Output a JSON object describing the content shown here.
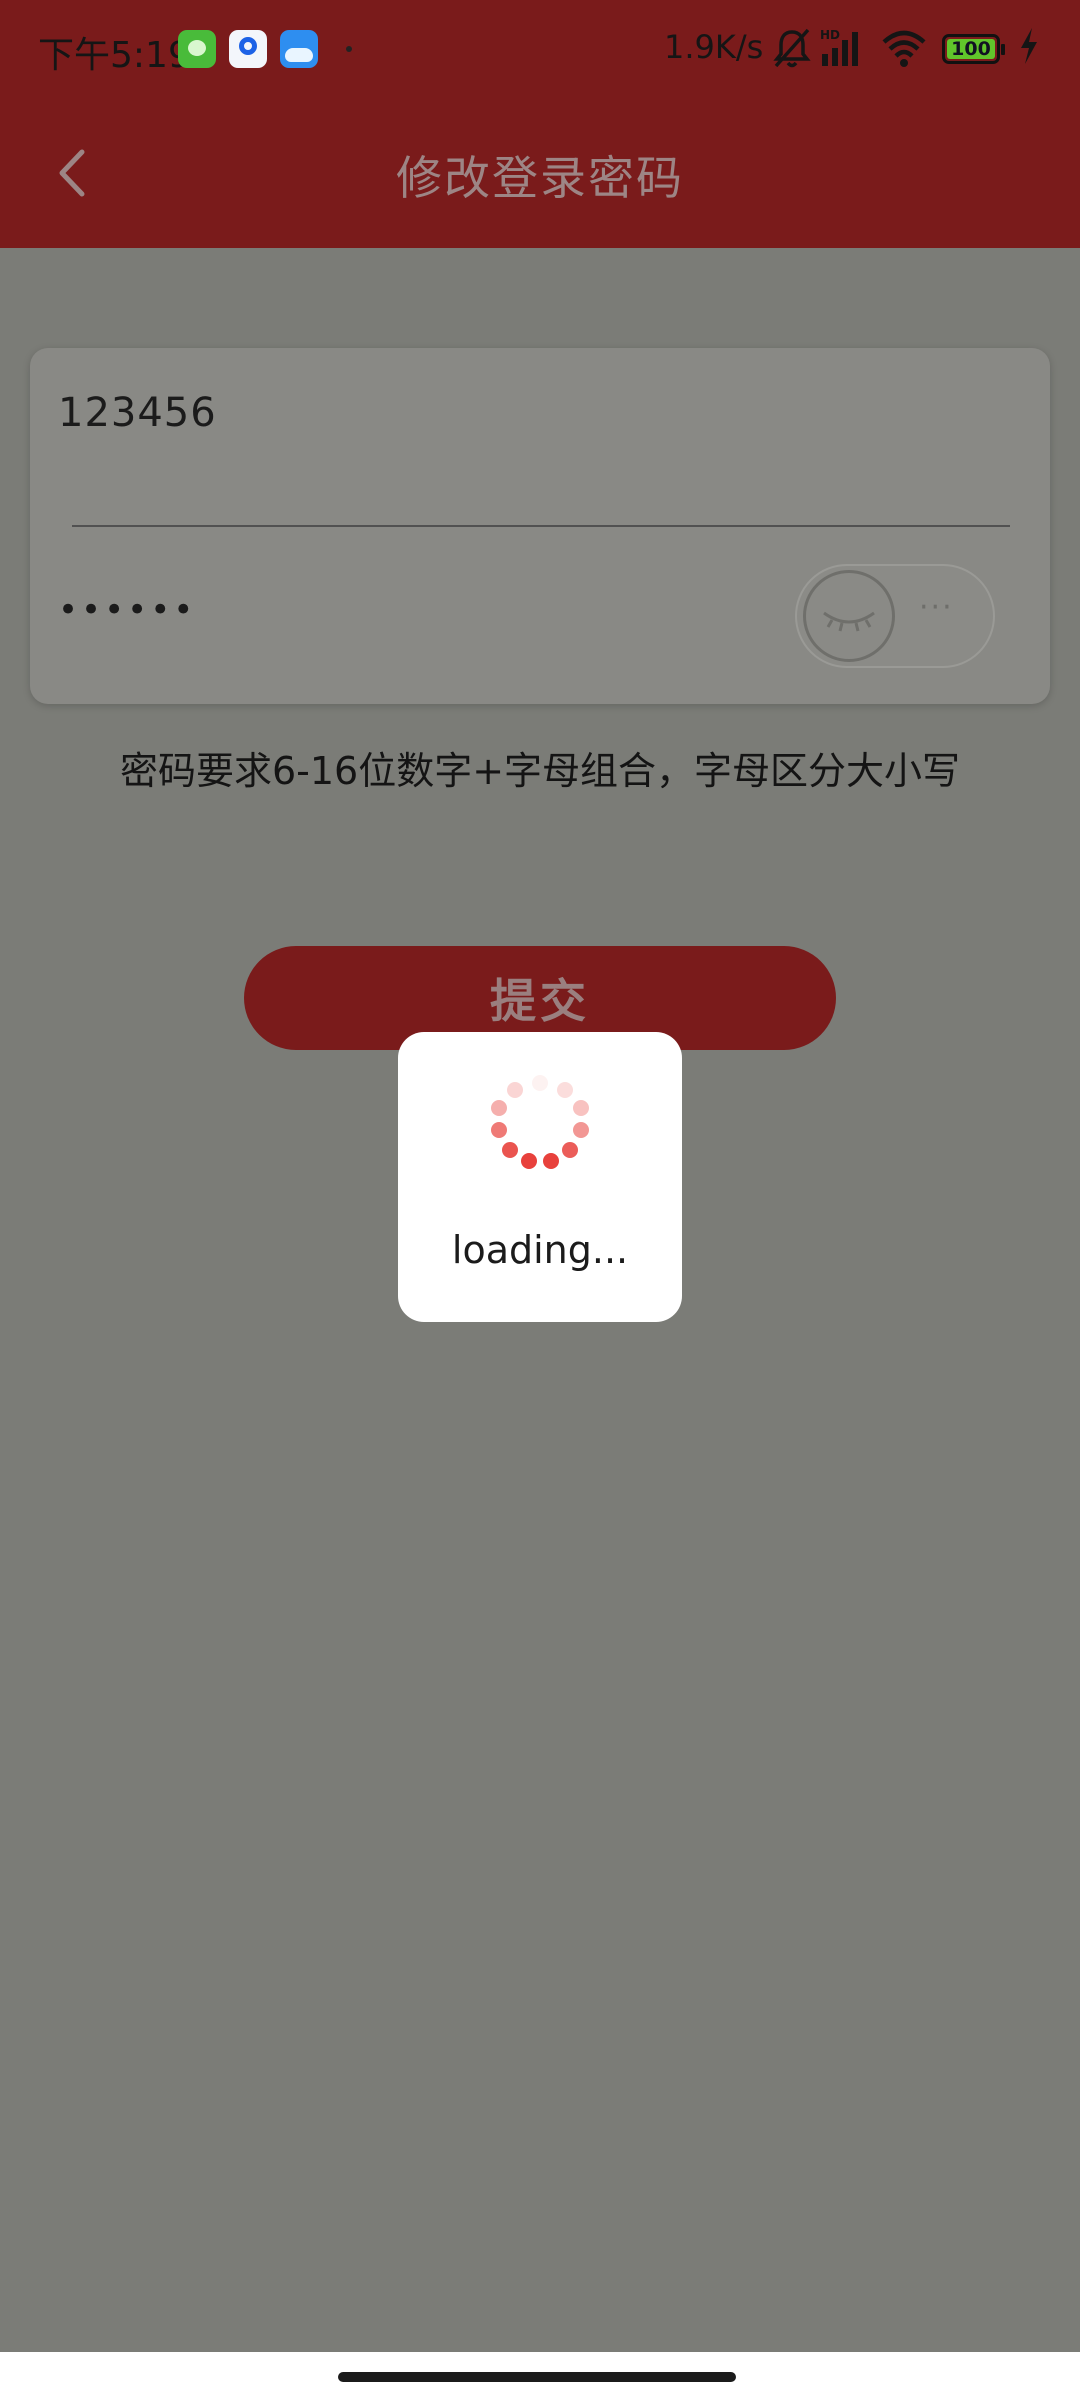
{
  "status_bar": {
    "time": "下午5:19",
    "network_speed": "1.9K/s",
    "battery_level": "100",
    "icons": [
      "cat-app-icon",
      "browser-app-icon",
      "cloud-app-icon",
      "mute-icon",
      "hd-signal-icon",
      "wifi-icon",
      "battery-icon",
      "charging-icon"
    ]
  },
  "header": {
    "title": "修改登录密码",
    "back_icon": "chevron-left-icon"
  },
  "form": {
    "new_password_value": "123456",
    "confirm_password_masked": "••••••",
    "visibility_toggle_icon": "eye-closed-icon",
    "hint": "密码要求6-16位数字+字母组合，字母区分大小写"
  },
  "submit_label": "提交",
  "loading": {
    "text": "loading..."
  },
  "colors": {
    "header_bg": "#7a1b1b",
    "overlay_bg": "#7b7c77",
    "spinner": "#e8413c"
  }
}
